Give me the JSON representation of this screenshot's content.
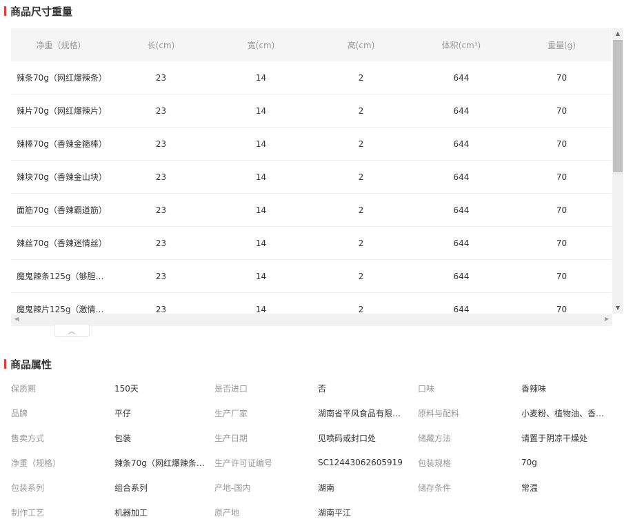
{
  "size_section": {
    "title": "商品尺寸重量",
    "headers": [
      "净重（规格）",
      "长(cm)",
      "宽(cm)",
      "高(cm)",
      "体积(cm³)",
      "重量(g)"
    ],
    "rows": [
      [
        "辣条70g（网红爆辣条）",
        "23",
        "14",
        "2",
        "644",
        "70"
      ],
      [
        "辣片70g（网红爆辣片）",
        "23",
        "14",
        "2",
        "644",
        "70"
      ],
      [
        "辣棒70g（香辣金箍棒）",
        "23",
        "14",
        "2",
        "644",
        "70"
      ],
      [
        "辣块70g（香辣金山块）",
        "23",
        "14",
        "2",
        "644",
        "70"
      ],
      [
        "面筋70g（香辣霸道筋）",
        "23",
        "14",
        "2",
        "644",
        "70"
      ],
      [
        "辣丝70g（香辣迷情丝）",
        "23",
        "14",
        "2",
        "644",
        "70"
      ],
      [
        "魔鬼辣条125g（够胆…",
        "23",
        "14",
        "2",
        "644",
        "70"
      ],
      [
        "魔鬼辣片125g（激情…",
        "23",
        "14",
        "2",
        "644",
        "70"
      ]
    ],
    "scroll_up_glyph": "▲",
    "scroll_down_glyph": "▼",
    "scroll_left_glyph": "◀",
    "scroll_right_glyph": "▶",
    "collapse_glyph": "︿"
  },
  "attr_section": {
    "title": "商品属性",
    "rows": [
      [
        [
          "保质期",
          "150天"
        ],
        [
          "是否进口",
          "否"
        ],
        [
          "口味",
          "香辣味"
        ]
      ],
      [
        [
          "品牌",
          "平仔"
        ],
        [
          "生产厂家",
          "湖南省平风食品有限…"
        ],
        [
          "原料与配料",
          "小麦粉、植物油、香…"
        ]
      ],
      [
        [
          "售卖方式",
          "包装"
        ],
        [
          "生产日期",
          "见喷码或封口处"
        ],
        [
          "储藏方法",
          "请置于阴凉干燥处"
        ]
      ],
      [
        [
          "净重（规格）",
          "辣条70g（网红爆辣条…"
        ],
        [
          "生产许可证编号",
          "SC12443062605919"
        ],
        [
          "包装规格",
          "70g"
        ]
      ],
      [
        [
          "包装系列",
          "组合系列"
        ],
        [
          "产地-国内",
          "湖南"
        ],
        [
          "储存条件",
          "常温"
        ]
      ],
      [
        [
          "制作工艺",
          "机器加工"
        ],
        [
          "原产地",
          "湖南平江"
        ]
      ]
    ]
  },
  "colors": {
    "accent": "#e4393c",
    "header_bg": "#f5f5f5",
    "label": "#999999",
    "text": "#333333"
  }
}
